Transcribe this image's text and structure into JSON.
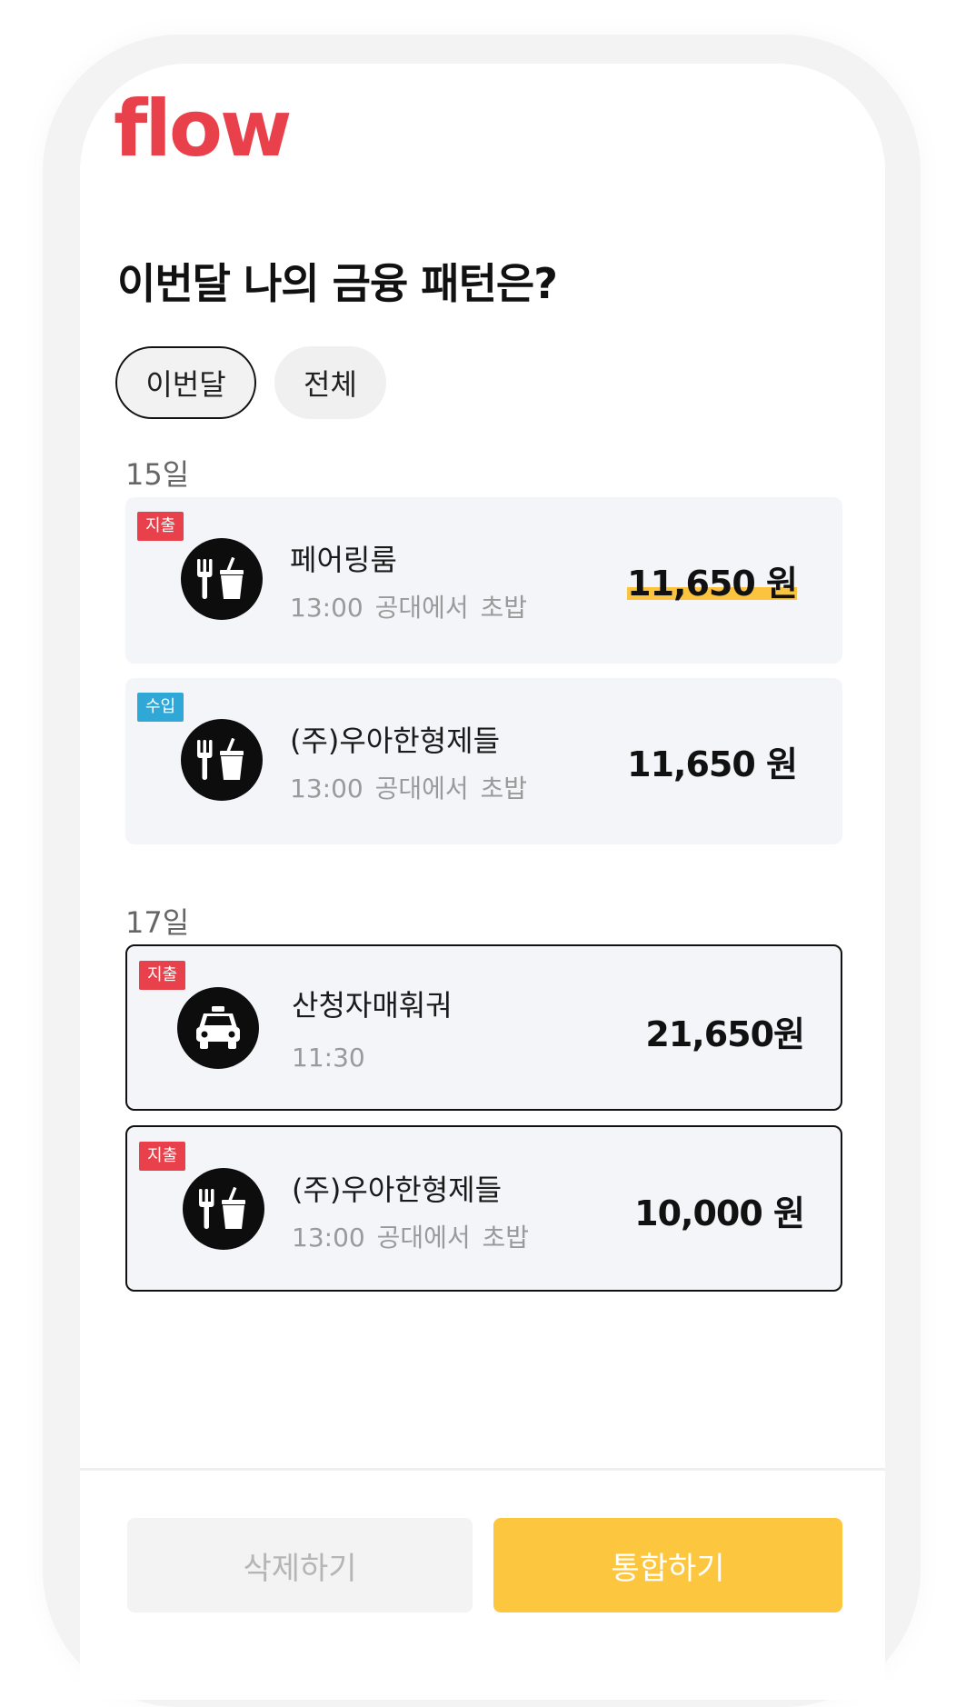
{
  "logo_text": "flow",
  "page_title": "이번달 나의 금융 패턴은?",
  "filters": {
    "this_month": "이번달",
    "all": "전체"
  },
  "groups": [
    {
      "date": "15일",
      "transactions": [
        {
          "badge": "지출",
          "merchant": "페어링룸",
          "meta": "13:00 공대에서 초밥",
          "amount": "11,650 원",
          "icon": "food-icon"
        },
        {
          "badge": "수입",
          "merchant": "(주)우아한형제들",
          "meta": "13:00 공대에서 초밥",
          "amount": "11,650 원",
          "icon": "food-icon"
        }
      ]
    },
    {
      "date": "17일",
      "transactions": [
        {
          "badge": "지출",
          "merchant": "산청자매훠궈",
          "meta": "11:30",
          "amount": "21,650원",
          "icon": "taxi-icon"
        },
        {
          "badge": "지출",
          "merchant": "(주)우아한형제들",
          "meta": "13:00 공대에서 초밥",
          "amount": "10,000 원",
          "icon": "food-icon"
        }
      ]
    }
  ],
  "actions": {
    "delete": "삭제하기",
    "merge": "통합하기"
  },
  "colors": {
    "brand": "#e8414b",
    "expense": "#e8414b",
    "income": "#2fa8d8",
    "accent": "#fdc63f"
  }
}
